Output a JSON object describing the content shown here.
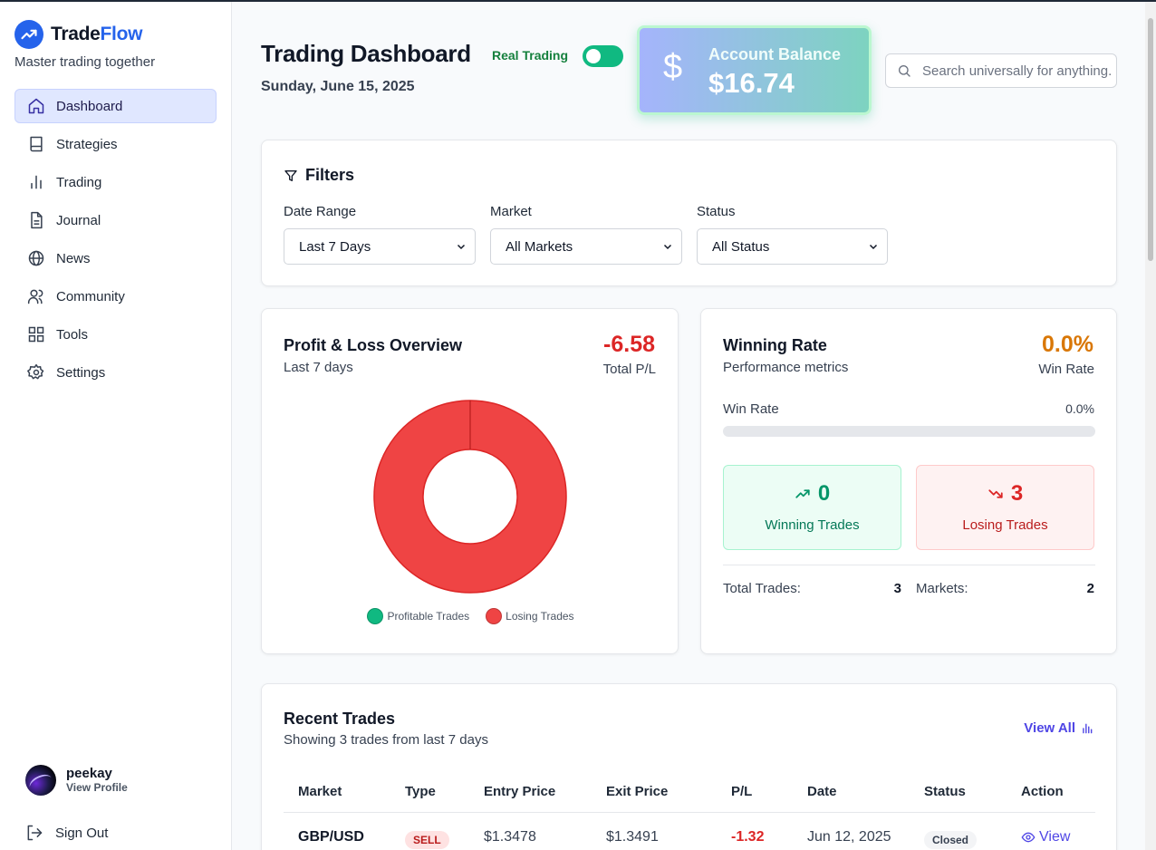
{
  "brand": {
    "name_main": "Trade",
    "name_accent": "Flow",
    "tagline": "Master trading together"
  },
  "sidebar": {
    "items": [
      {
        "label": "Dashboard",
        "icon": "home-icon",
        "active": true
      },
      {
        "label": "Strategies",
        "icon": "book-icon"
      },
      {
        "label": "Trading",
        "icon": "bar-chart-icon"
      },
      {
        "label": "Journal",
        "icon": "file-text-icon"
      },
      {
        "label": "News",
        "icon": "globe-icon"
      },
      {
        "label": "Community",
        "icon": "users-icon"
      },
      {
        "label": "Tools",
        "icon": "grid-icon"
      },
      {
        "label": "Settings",
        "icon": "gear-icon"
      }
    ],
    "profile": {
      "name": "peekay",
      "link": "View Profile"
    },
    "signout": "Sign Out"
  },
  "header": {
    "title": "Trading Dashboard",
    "date": "Sunday, June 15, 2025",
    "real_trading_label": "Real Trading",
    "real_trading_on": true,
    "balance_label": "Account Balance",
    "balance_value": "$16.74",
    "search_placeholder": "Search universally for anything..."
  },
  "filters": {
    "title": "Filters",
    "date_range": {
      "label": "Date Range",
      "value": "Last 7 Days"
    },
    "market": {
      "label": "Market",
      "value": "All Markets"
    },
    "status": {
      "label": "Status",
      "value": "All Status"
    }
  },
  "pl": {
    "title": "Profit & Loss Overview",
    "subtitle": "Last 7 days",
    "total": "-6.58",
    "total_label": "Total P/L"
  },
  "chart_data": {
    "type": "pie",
    "categories": [
      "Profitable Trades",
      "Losing Trades"
    ],
    "values": [
      0,
      3
    ],
    "colors": [
      "#10b981",
      "#ef4444"
    ],
    "legend": "bottom"
  },
  "winrate": {
    "title": "Winning Rate",
    "subtitle": "Performance metrics",
    "value": "0.0%",
    "value_label": "Win Rate",
    "bar_label": "Win Rate",
    "bar_value": "0.0%",
    "bar_fraction": 0.0,
    "winning_count": "0",
    "winning_label": "Winning Trades",
    "losing_count": "3",
    "losing_label": "Losing Trades",
    "total_trades_label": "Total Trades:",
    "total_trades": "3",
    "markets_label": "Markets:",
    "markets": "2"
  },
  "trades": {
    "title": "Recent Trades",
    "subtitle": "Showing 3 trades from last 7 days",
    "view_all": "View All",
    "columns": [
      "Market",
      "Type",
      "Entry Price",
      "Exit Price",
      "P/L",
      "Date",
      "Status",
      "Action"
    ],
    "rows": [
      {
        "market": "GBP/USD",
        "type": "SELL",
        "entry": "$1.3478",
        "exit": "$1.3491",
        "pl": "-1.32",
        "date": "Jun 12, 2025",
        "status": "Closed",
        "action": "View"
      }
    ]
  }
}
